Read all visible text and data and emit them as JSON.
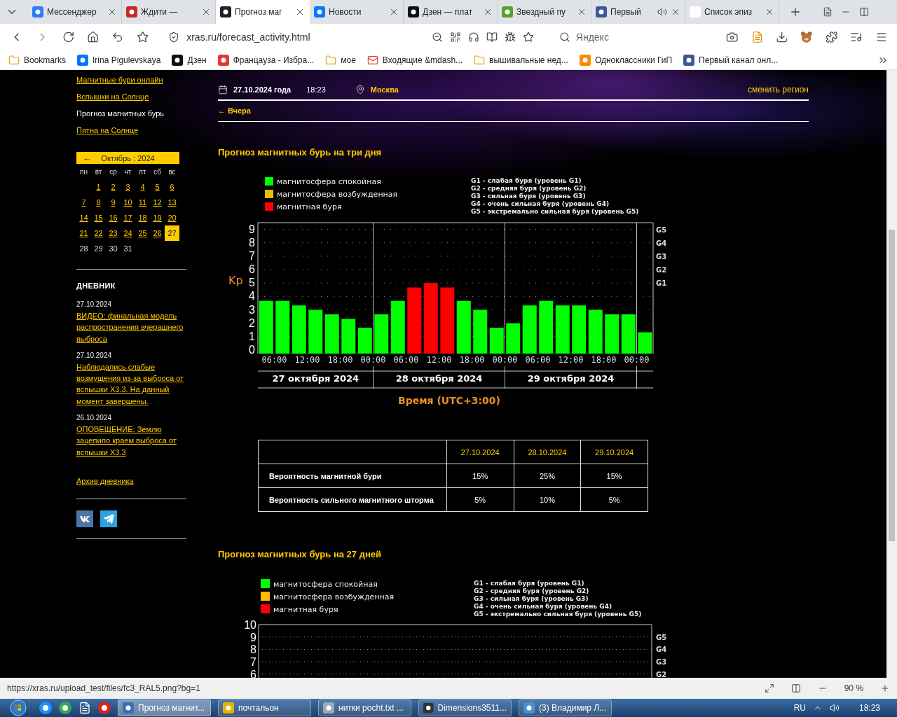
{
  "browser": {
    "tabs": [
      {
        "label": "Мессенджер",
        "selected": false,
        "audio": false
      },
      {
        "label": "Ждити —",
        "selected": false,
        "audio": false
      },
      {
        "label": "Прогноз маг",
        "selected": true,
        "audio": false
      },
      {
        "label": "Новости",
        "selected": false,
        "audio": false
      },
      {
        "label": "Дзен — плат",
        "selected": false,
        "audio": false
      },
      {
        "label": "Звездный пу",
        "selected": false,
        "audio": false
      },
      {
        "label": "Первый",
        "selected": false,
        "audio": true
      },
      {
        "label": "Список эпиз",
        "selected": false,
        "audio": false
      }
    ],
    "address": "xras.ru/forecast_activity.html",
    "search": {
      "placeholder": "Яндекс"
    },
    "bookmarks": [
      {
        "label": "Bookmarks",
        "kind": "folder"
      },
      {
        "label": "Irina Pigulevskaya",
        "kind": "site"
      },
      {
        "label": "Дзен",
        "kind": "site"
      },
      {
        "label": "Францауза - Избра...",
        "kind": "site"
      },
      {
        "label": "мое",
        "kind": "folder"
      },
      {
        "label": "Входящие &mdash...",
        "kind": "mail"
      },
      {
        "label": "вышивальные нед...",
        "kind": "folder"
      },
      {
        "label": "Одноклассники ГиП",
        "kind": "site"
      },
      {
        "label": "Первый канал онл...",
        "kind": "site"
      }
    ]
  },
  "sidebar": {
    "links": [
      {
        "label": "Магнитные бури онлайн",
        "selected": false
      },
      {
        "label": "Вспышки на Солнце",
        "selected": false
      },
      {
        "label": "Прогноз магнитных бурь",
        "selected": true
      },
      {
        "label": "Пятна на Солнце",
        "selected": false
      }
    ],
    "calendar": {
      "prev": "←",
      "month": "Октябрь : 2024",
      "weekdays": [
        "пн",
        "вт",
        "ср",
        "чт",
        "пт",
        "сб",
        "вс"
      ],
      "days": [
        {
          "label": "1",
          "link": true,
          "selected": false
        },
        {
          "label": "2",
          "link": true,
          "selected": false
        },
        {
          "label": "3",
          "link": true,
          "selected": false
        },
        {
          "label": "4",
          "link": true,
          "selected": false
        },
        {
          "label": "5",
          "link": true,
          "selected": false
        },
        {
          "label": "6",
          "link": true,
          "selected": false
        },
        {
          "label": "7",
          "link": true,
          "selected": false
        },
        {
          "label": "8",
          "link": true,
          "selected": false
        },
        {
          "label": "9",
          "link": true,
          "selected": false
        },
        {
          "label": "10",
          "link": true,
          "selected": false
        },
        {
          "label": "11",
          "link": true,
          "selected": false
        },
        {
          "label": "12",
          "link": true,
          "selected": false
        },
        {
          "label": "13",
          "link": true,
          "selected": false
        },
        {
          "label": "14",
          "link": true,
          "selected": false
        },
        {
          "label": "15",
          "link": true,
          "selected": false
        },
        {
          "label": "16",
          "link": true,
          "selected": false
        },
        {
          "label": "17",
          "link": true,
          "selected": false
        },
        {
          "label": "18",
          "link": true,
          "selected": false
        },
        {
          "label": "19",
          "link": true,
          "selected": false
        },
        {
          "label": "20",
          "link": true,
          "selected": false
        },
        {
          "label": "21",
          "link": true,
          "selected": false
        },
        {
          "label": "22",
          "link": true,
          "selected": false
        },
        {
          "label": "23",
          "link": true,
          "selected": false
        },
        {
          "label": "24",
          "link": true,
          "selected": false
        },
        {
          "label": "25",
          "link": true,
          "selected": false
        },
        {
          "label": "26",
          "link": true,
          "selected": false
        },
        {
          "label": "27",
          "link": false,
          "selected": true
        },
        {
          "label": "28",
          "link": false,
          "selected": false
        },
        {
          "label": "29",
          "link": false,
          "selected": false
        },
        {
          "label": "30",
          "link": false,
          "selected": false
        },
        {
          "label": "31",
          "link": false,
          "selected": false
        }
      ]
    },
    "diary": {
      "title": "ДНЕВНИК",
      "entries": [
        {
          "date": "27.10.2024",
          "title": "ВИДЕО: финальная модель распространения вчерашнего выброса"
        },
        {
          "date": "27.10.2024",
          "title": "Наблюдались слабые возмущения из-за выброса от вспышки X3.3. На данный момент завершены."
        },
        {
          "date": "26.10.2024",
          "title": "ОПОВЕЩЕНИЕ: Землю зацепило краем выброса от вспышки X3.3"
        }
      ],
      "archive": "Архив дневника"
    }
  },
  "header": {
    "date": "27.10.2024 года",
    "time": "18:23",
    "city": "Москва",
    "change_region": "сменить регион",
    "yesterday": "← Вчера"
  },
  "forecast_3days": {
    "title": "Прогноз магнитных бурь на три дня",
    "scale": [
      "G1 - слабая буря (уровень G1)",
      "G2 - средняя буря (уровень G2)",
      "G3 - сильная буря (уровень G3)",
      "G4 - очень сильная буря (уровень G4)",
      "G5 - экстремально сильная буря (уровень G5)"
    ],
    "right_axis_labels": [
      "G5",
      "G4",
      "G3",
      "G2",
      "G1"
    ],
    "days": [
      "27 октября 2024",
      "28 октября 2024",
      "29 октября 2024"
    ],
    "time_labels": [
      "06:00",
      "12:00",
      "18:00",
      "00:00",
      "06:00",
      "12:00",
      "18:00",
      "00:00",
      "06:00",
      "12:00",
      "18:00",
      "00:00"
    ],
    "chart_data": {
      "type": "bar",
      "xlabel": "Время (UTC+3:00)",
      "ylabel": "Kp",
      "stacked": true,
      "grid": true,
      "legend": "top-left",
      "categories": [
        null,
        null,
        null,
        null,
        null,
        null,
        null,
        null,
        null,
        null,
        null,
        null,
        null,
        null,
        null,
        null,
        null,
        null,
        null,
        null,
        null,
        null,
        null,
        null
      ],
      "series": [
        {
          "name": "магнитосфера спокойная",
          "color": "#00ff00",
          "values": [
            3.67,
            3.67,
            3.33,
            3,
            2.67,
            2.33,
            1.67,
            2.67,
            3.67,
            null,
            null,
            null,
            3.67,
            3,
            1.67,
            2,
            3.33,
            3.67,
            3.33,
            3.33,
            3,
            2.67,
            2.67,
            1.33
          ]
        },
        {
          "name": "магнитосфера возбужденная",
          "color": "#e6c000",
          "values": [
            null,
            null,
            null,
            null,
            null,
            null,
            null,
            null,
            null,
            null,
            null,
            null,
            null,
            null,
            null,
            null,
            null,
            null,
            null,
            null,
            null,
            null,
            null,
            null
          ]
        },
        {
          "name": "магнитная буря",
          "color": "#ff0000",
          "values": [
            null,
            null,
            null,
            null,
            null,
            null,
            null,
            null,
            null,
            4.67,
            5,
            4.67,
            null,
            null,
            null,
            null,
            null,
            null,
            null,
            null,
            null,
            null,
            null,
            null
          ]
        }
      ],
      "ylim": [
        0,
        9.5
      ],
      "yticks": [
        0,
        1,
        2,
        3,
        4,
        5,
        6,
        7,
        8,
        9
      ]
    }
  },
  "forecast_table": {
    "columns": [
      "27.10.2024",
      "28.10.2024",
      "29.10.2024"
    ],
    "rows": [
      {
        "label": "Вероятность магнитной бури",
        "values": [
          "15%",
          "25%",
          "15%"
        ]
      },
      {
        "label": "Вероятность сильного магнитного шторма",
        "values": [
          "5%",
          "10%",
          "5%"
        ]
      }
    ]
  },
  "forecast_27days": {
    "title": "Прогноз магнитных бурь на 27 дней",
    "legend": [
      {
        "label": "магнитосфера спокойная",
        "color": "#00ff00"
      },
      {
        "label": "магнитосфера возбужденная",
        "color": "#ffbb00"
      },
      {
        "label": "магнитная буря",
        "color": "#ff0000"
      }
    ],
    "scale": [
      "G1 - слабая буря (уровень G1)",
      "G2 - средняя буря (уровень G2)",
      "G3 - сильная буря (уровень G3)",
      "G4 - очень сильная буря (уровень G4)",
      "G5 - экстремально сильная буря (уровень G5)"
    ],
    "y_labels": [
      "10",
      "9",
      "8",
      "7",
      "6"
    ],
    "right_axis_labels": [
      "G5",
      "G4",
      "G3",
      "G2"
    ]
  },
  "status_bar": {
    "url": "https://xras.ru/upload_test/files/fc3_RAL5.png?bg=1",
    "zoom": "90 %"
  },
  "taskbar": {
    "windows": [
      {
        "label": "Прогноз магнит...",
        "selected": true
      },
      {
        "label": "почтальон",
        "selected": false
      },
      {
        "label": "нитки pocht.txt ...",
        "selected": false
      },
      {
        "label": "Dimensions3511...",
        "selected": false
      },
      {
        "label": "(3) Владимир Л...",
        "selected": false
      }
    ],
    "language": "RU",
    "clock": "18:23"
  }
}
